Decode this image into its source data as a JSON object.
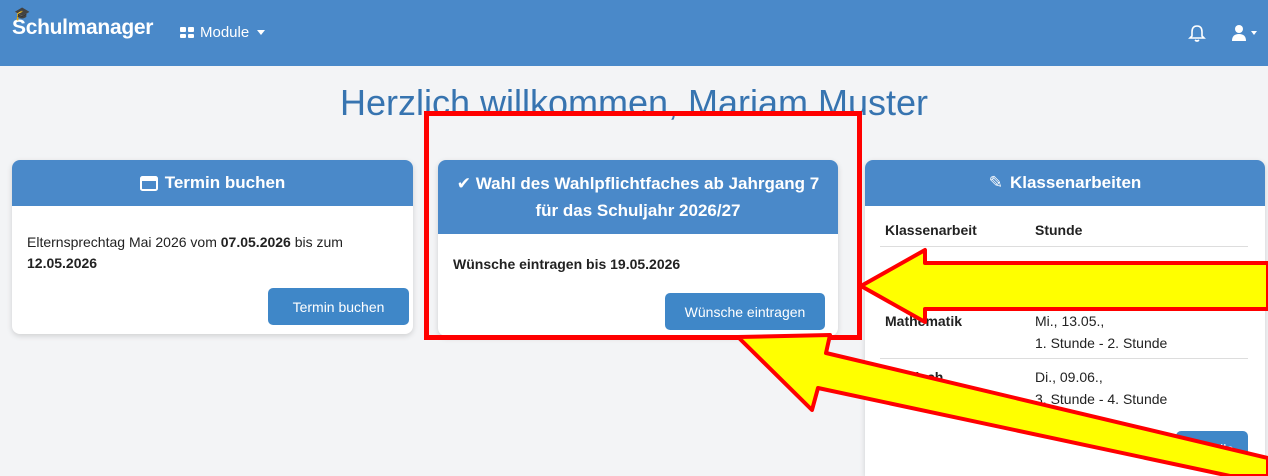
{
  "navbar": {
    "brand": "Schulmanager",
    "modules_label": "Module",
    "icons": [
      "graduation-cap-icon",
      "grid-icon",
      "caret-down-icon",
      "bell-icon",
      "user-icon"
    ]
  },
  "welcome": "Herzlich willkommen, Mariam Muster",
  "termin": {
    "title": "Termin buchen",
    "text_prefix": "Elternsprechtag Mai 2026 vom ",
    "date_from": "07.05.2026",
    "text_mid": " bis zum",
    "date_to": "12.05.2026",
    "button": "Termin buchen"
  },
  "wahl": {
    "title": "Wahl des Wahlpflichtfaches ab Jahrgang 7 für das Schuljahr 2026/27",
    "deadline": "Wünsche eintragen bis 19.05.2026",
    "button": "Wünsche eintragen"
  },
  "klassenarbeiten": {
    "title": "Klassenarbeiten",
    "col1": "Klassenarbeit",
    "col2": "Stunde",
    "rows": [
      {
        "subject": "Mathematik",
        "date": "Mi., 13.05.,",
        "time": "1. Stunde - 2. Stunde"
      },
      {
        "subject": "Englisch",
        "date": "Di., 09.06.,",
        "time": "3. Stunde - 4. Stunde"
      }
    ],
    "button": "Details"
  },
  "colors": {
    "primary": "#4a89c9",
    "heading": "#3774b0",
    "annotation_red": "#ff0000",
    "annotation_yellow": "#ffff00"
  }
}
